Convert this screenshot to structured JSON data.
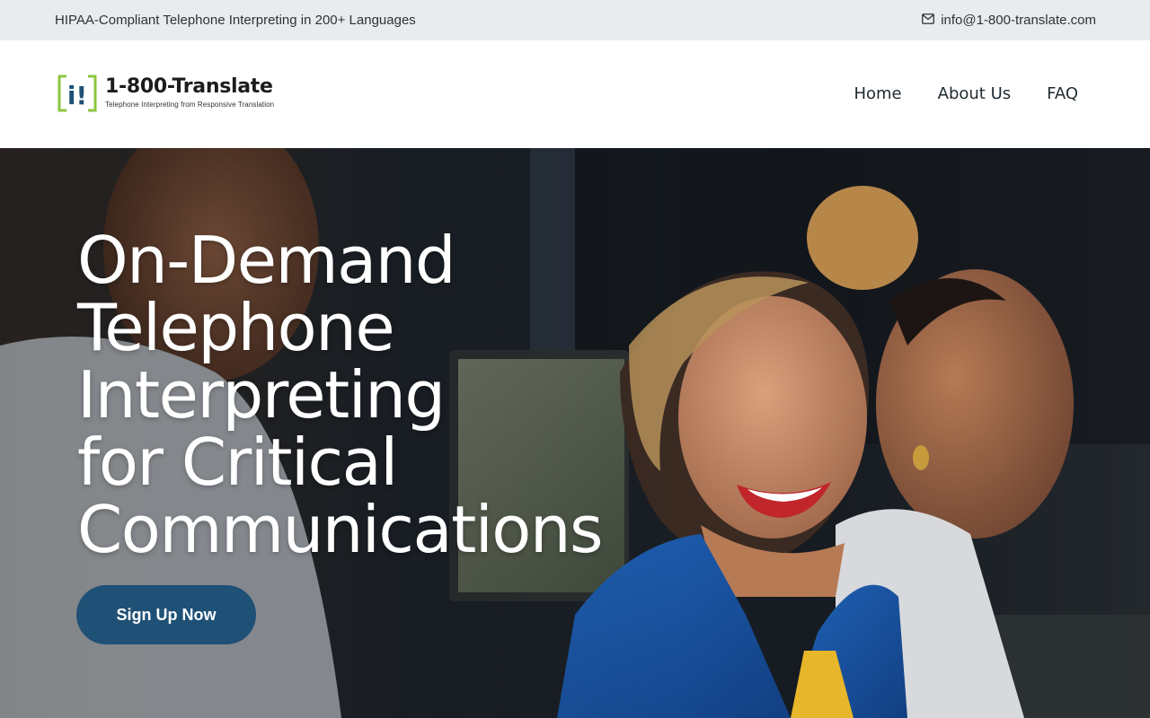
{
  "topbar": {
    "tagline": "HIPAA-Compliant Telephone Interpreting in 200+ Languages",
    "email_icon": "envelope-icon",
    "email": "info@1-800-translate.com"
  },
  "header": {
    "logo": {
      "mark_text": "i!",
      "title": "1-800-Translate",
      "tagline": "Telephone Interpreting from Responsive Translation"
    },
    "nav": [
      {
        "label": "Home"
      },
      {
        "label": "About Us"
      },
      {
        "label": "FAQ"
      }
    ]
  },
  "hero": {
    "title_lines": [
      "On-Demand",
      "Telephone",
      "Interpreting",
      "for Critical",
      "Communications"
    ],
    "cta_label": "Sign Up Now"
  },
  "colors": {
    "topbar_bg": "#e9ecef",
    "cta_bg": "#1f5076",
    "logo_green": "#8cc63f",
    "logo_blue": "#1f5076"
  }
}
